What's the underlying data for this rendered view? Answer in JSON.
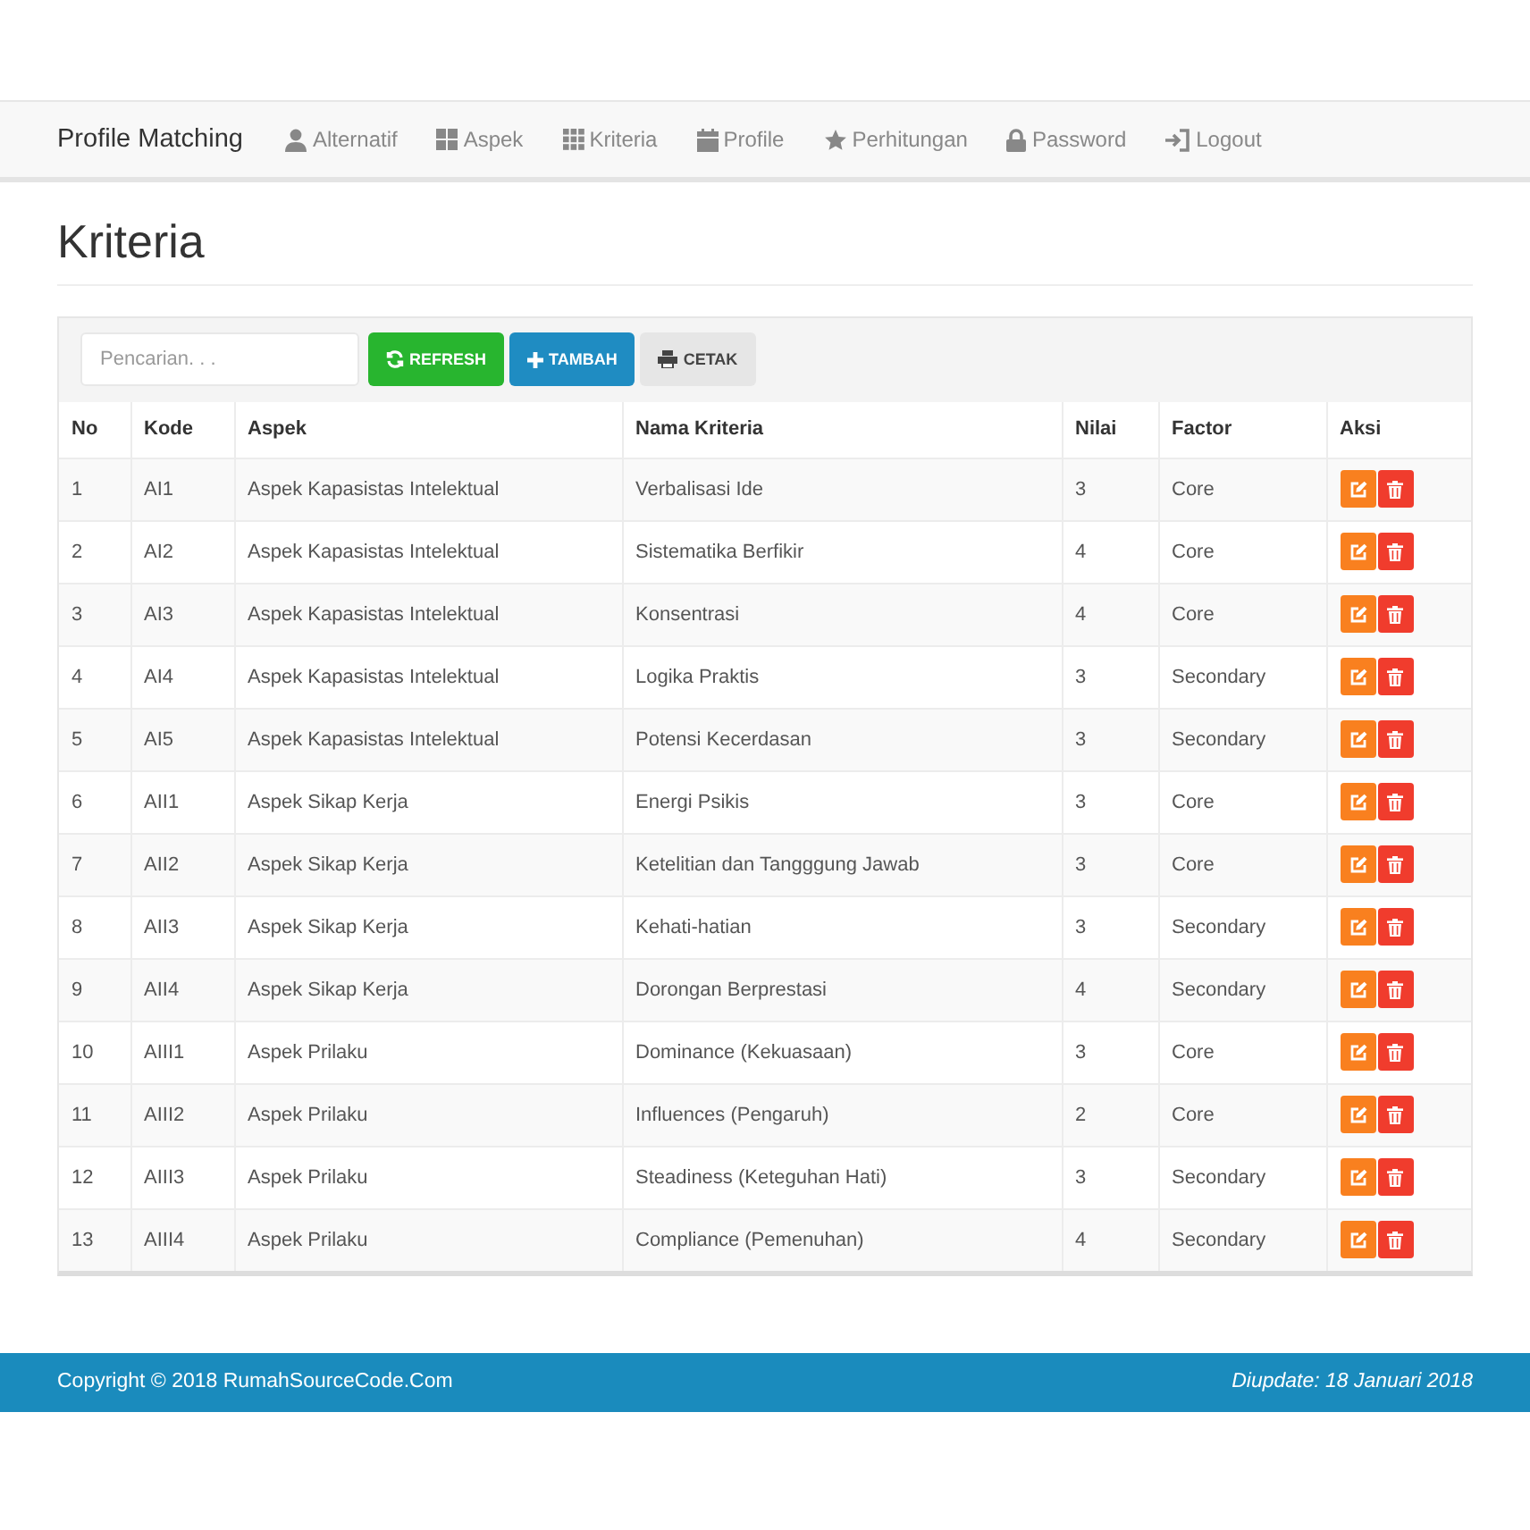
{
  "navbar": {
    "brand": "Profile Matching",
    "items": [
      {
        "label": "Alternatif"
      },
      {
        "label": "Aspek"
      },
      {
        "label": "Kriteria"
      },
      {
        "label": "Profile"
      },
      {
        "label": "Perhitungan"
      },
      {
        "label": "Password"
      },
      {
        "label": "Logout"
      }
    ]
  },
  "page_title": "Kriteria",
  "toolbar": {
    "search": {
      "placeholder": "Pencarian. . ."
    },
    "buttons": [
      {
        "label": "REFRESH",
        "kind": "refresh"
      },
      {
        "label": "TAMBAH",
        "kind": "add"
      },
      {
        "label": "CETAK",
        "kind": "print"
      }
    ]
  },
  "table": {
    "columns": [
      "No",
      "Kode",
      "Aspek",
      "Nama Kriteria",
      "Nilai",
      "Factor",
      "Aksi"
    ],
    "rows": [
      [
        "1",
        "AI1",
        "Aspek Kapasistas Intelektual",
        "Verbalisasi Ide",
        "3",
        "Core"
      ],
      [
        "2",
        "AI2",
        "Aspek Kapasistas Intelektual",
        "Sistematika Berfikir",
        "4",
        "Core"
      ],
      [
        "3",
        "AI3",
        "Aspek Kapasistas Intelektual",
        "Konsentrasi",
        "4",
        "Core"
      ],
      [
        "4",
        "AI4",
        "Aspek Kapasistas Intelektual",
        "Logika Praktis",
        "3",
        "Secondary"
      ],
      [
        "5",
        "AI5",
        "Aspek Kapasistas Intelektual",
        "Potensi Kecerdasan",
        "3",
        "Secondary"
      ],
      [
        "6",
        "AII1",
        "Aspek Sikap Kerja",
        "Energi Psikis",
        "3",
        "Core"
      ],
      [
        "7",
        "AII2",
        "Aspek Sikap Kerja",
        "Ketelitian dan Tangggung Jawab",
        "3",
        "Core"
      ],
      [
        "8",
        "AII3",
        "Aspek Sikap Kerja",
        "Kehati-hatian",
        "3",
        "Secondary"
      ],
      [
        "9",
        "AII4",
        "Aspek Sikap Kerja",
        "Dorongan Berprestasi",
        "4",
        "Secondary"
      ],
      [
        "10",
        "AIII1",
        "Aspek Prilaku",
        "Dominance (Kekuasaan)",
        "3",
        "Core"
      ],
      [
        "11",
        "AIII2",
        "Aspek Prilaku",
        "Influences (Pengaruh)",
        "2",
        "Core"
      ],
      [
        "12",
        "AIII3",
        "Aspek Prilaku",
        "Steadiness (Keteguhan Hati)",
        "3",
        "Secondary"
      ],
      [
        "13",
        "AIII4",
        "Aspek Prilaku",
        "Compliance (Pemenuhan)",
        "4",
        "Secondary"
      ]
    ]
  },
  "footer": {
    "copyright": "Copyright © 2018 RumahSourceCode.Com",
    "updated": "Diupdate: 18 Januari 2018"
  }
}
